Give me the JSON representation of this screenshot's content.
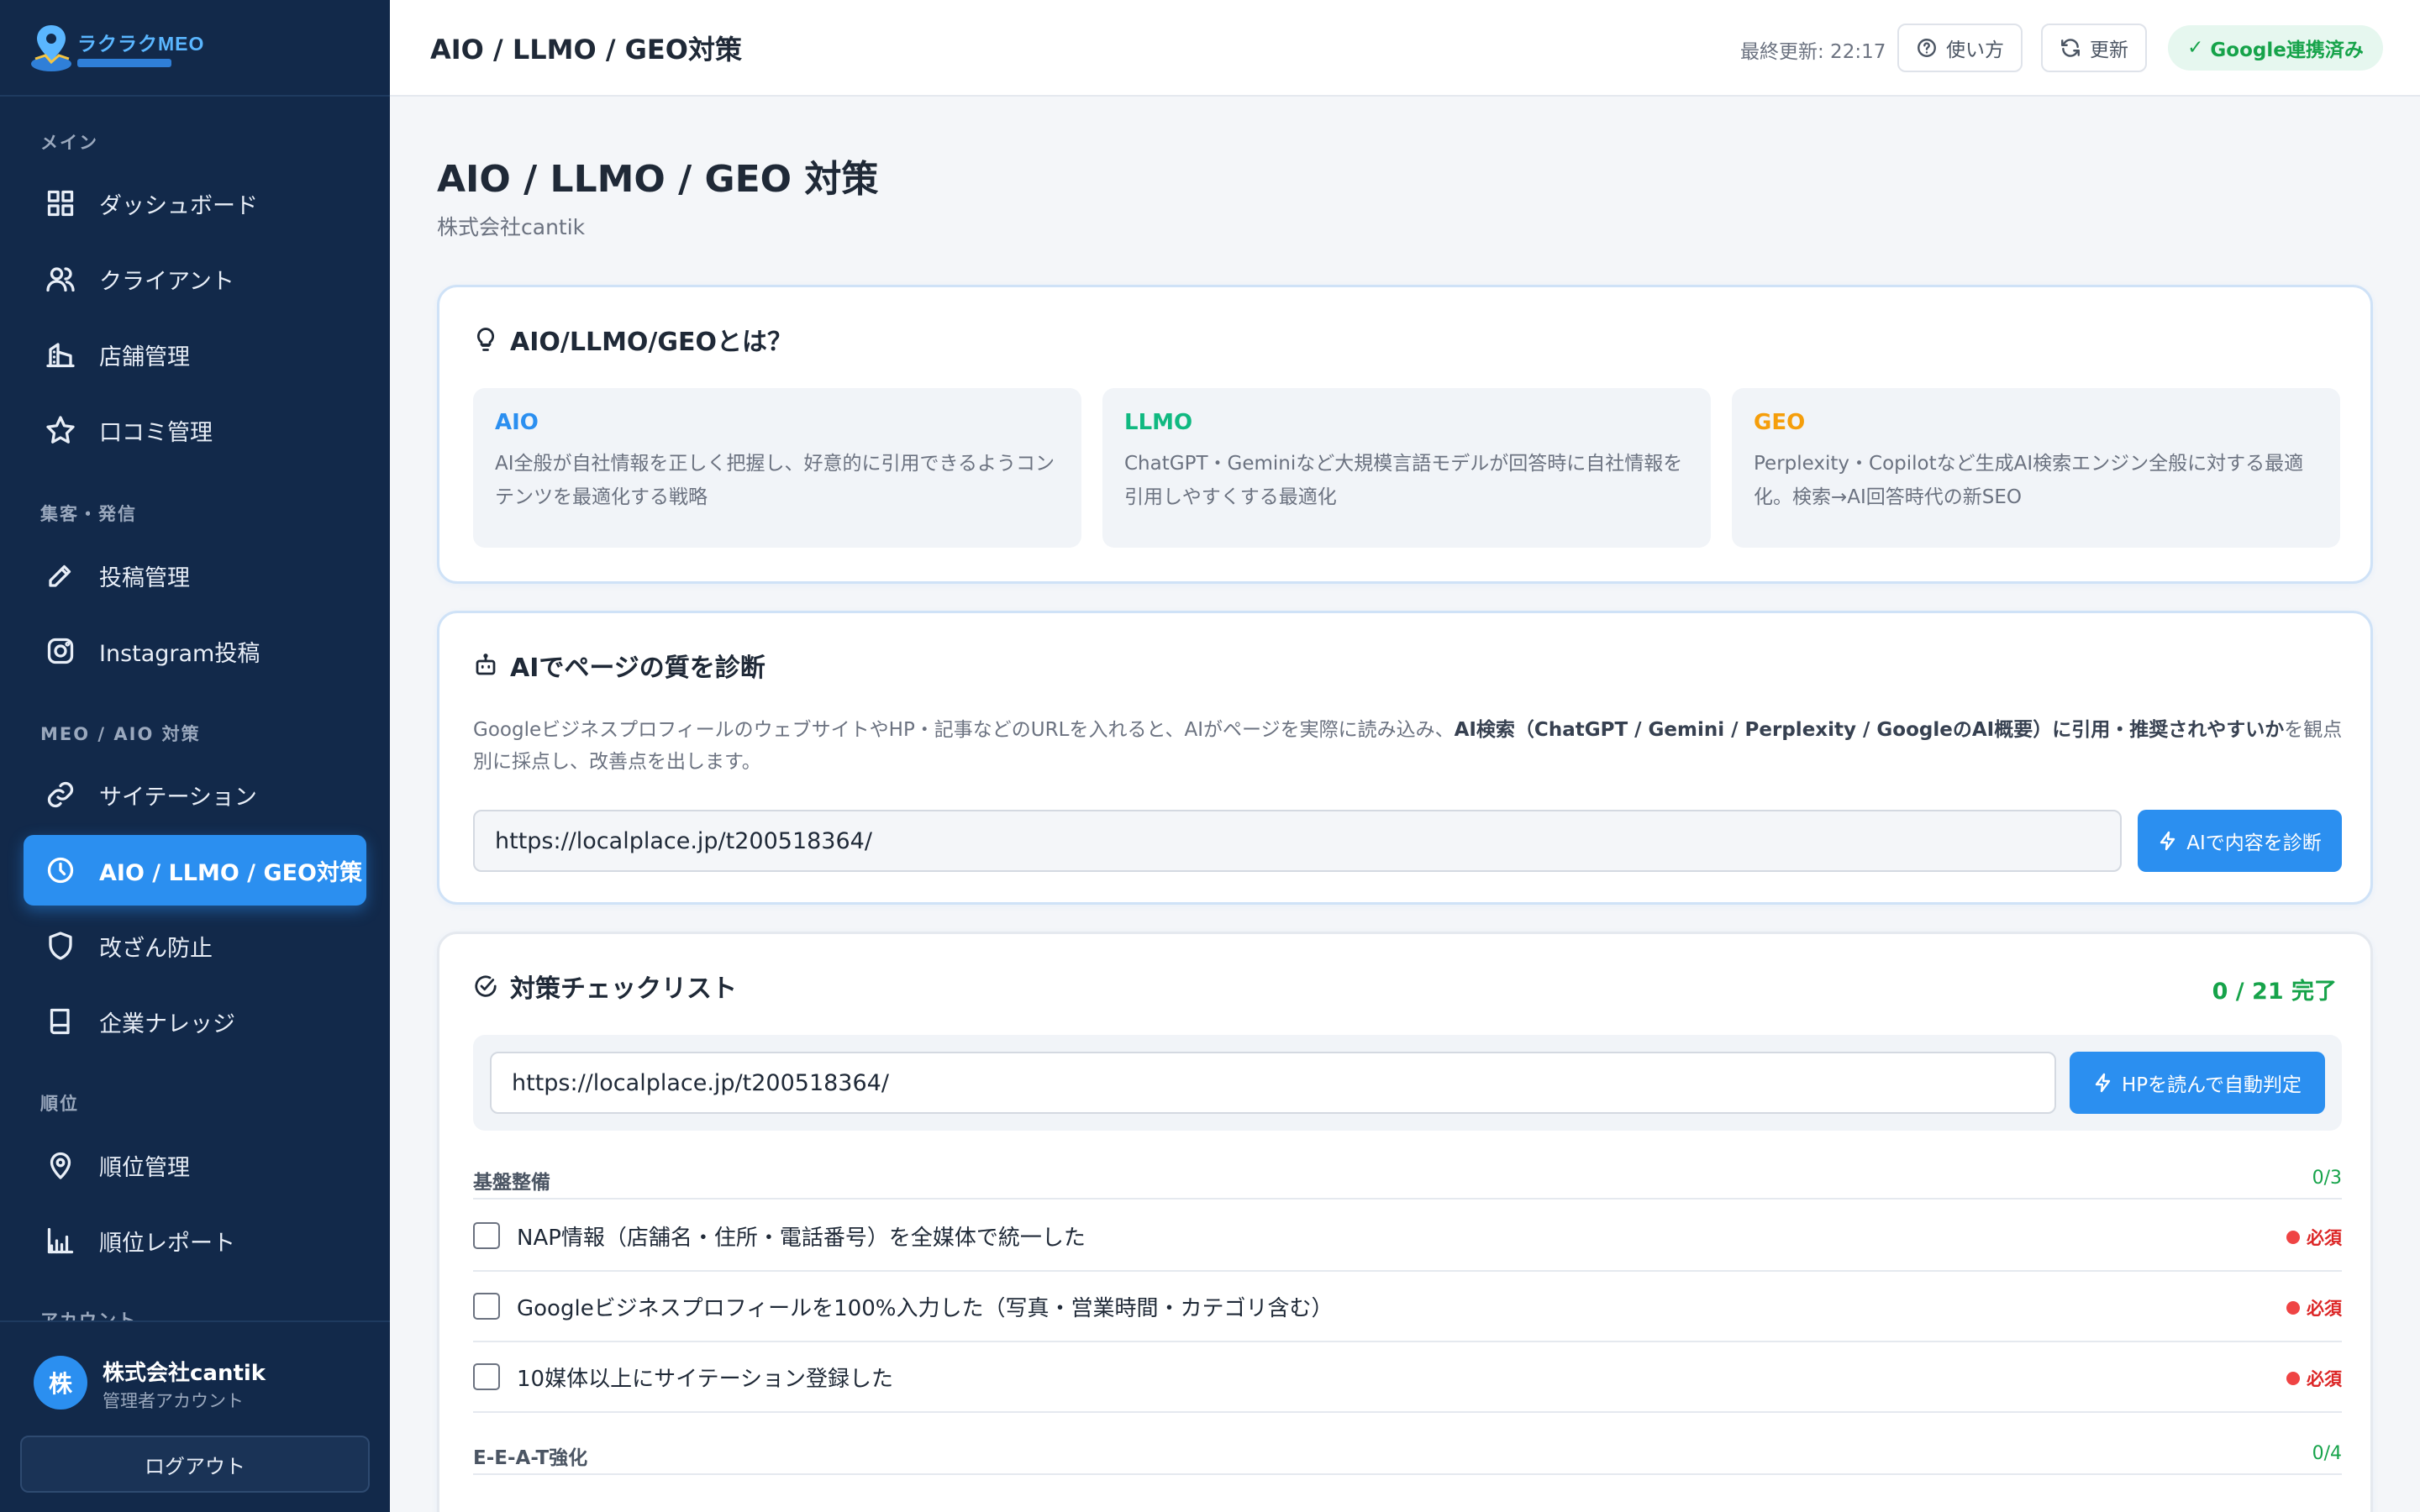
{
  "app": {
    "logo_text": "ラクラクMEO"
  },
  "sidebar": {
    "sections": [
      {
        "label": "メイン"
      },
      {
        "label": "集客・発信"
      },
      {
        "label": "MEO / AIO 対策"
      },
      {
        "label": "順位"
      },
      {
        "label": "アカウント"
      }
    ],
    "items": [
      {
        "label": "ダッシュボード",
        "icon": "grid-icon"
      },
      {
        "label": "クライアント",
        "icon": "users-icon"
      },
      {
        "label": "店舗管理",
        "icon": "building-icon"
      },
      {
        "label": "口コミ管理",
        "icon": "star-icon"
      },
      {
        "label": "投稿管理",
        "icon": "pencil-icon"
      },
      {
        "label": "Instagram投稿",
        "icon": "instagram-icon"
      },
      {
        "label": "サイテーション",
        "icon": "link-icon"
      },
      {
        "label": "AIO / LLMO / GEO対策",
        "icon": "clock-icon",
        "active": true
      },
      {
        "label": "改ざん防止",
        "icon": "shield-icon"
      },
      {
        "label": "企業ナレッジ",
        "icon": "book-icon"
      },
      {
        "label": "順位管理",
        "icon": "map-pin-icon"
      },
      {
        "label": "順位レポート",
        "icon": "bar-chart-icon"
      }
    ],
    "user": {
      "avatar": "株",
      "name": "株式会社cantik",
      "role": "管理者アカウント"
    },
    "logout_label": "ログアウト"
  },
  "header": {
    "title": "AIO / LLMO / GEO対策",
    "last_updated": "最終更新: 22:17",
    "help_label": "使い方",
    "refresh_label": "更新",
    "google_status": "Google連携済み"
  },
  "page": {
    "title": "AIO / LLMO / GEO 対策",
    "subtitle": "株式会社cantik"
  },
  "about": {
    "title": "AIO/LLMO/GEOとは？",
    "items": [
      {
        "name": "AIO",
        "color": "#2b8ff0",
        "desc": "AI全般が自社情報を正しく把握し、好意的に引用できるようコンテンツを最適化する戦略"
      },
      {
        "name": "LLMO",
        "color": "#10b981",
        "desc": "ChatGPT・Geminiなど大規模言語モデルが回答時に自社情報を引用しやすくする最適化"
      },
      {
        "name": "GEO",
        "color": "#f59e0b",
        "desc": "Perplexity・Copilotなど生成AI検索エンジン全般に対する最適化。検索→AI回答時代の新SEO"
      }
    ]
  },
  "diagnose": {
    "title": "AIでページの質を診断",
    "desc_before": "GoogleビジネスプロフィールのウェブサイトやHP・記事などのURLを入れると、AIがページを実際に読み込み、",
    "desc_bold": "AI検索（ChatGPT / Gemini / Perplexity / GoogleのAI概要）に引用・推奨されやすいか",
    "desc_after": "を観点別に採点し、改善点を出します。",
    "url_value": "https://localplace.jp/t200518364/",
    "button_label": "AIで内容を診断"
  },
  "checklist": {
    "title": "対策チェックリスト",
    "progress": "0 / 21 完了",
    "url_value": "https://localplace.jp/t200518364/",
    "auto_button_label": "HPを読んで自動判定",
    "groups": [
      {
        "name": "基盤整備",
        "count": "0/3",
        "items": [
          {
            "label": "NAP情報（店舗名・住所・電話番号）を全媒体で統一した",
            "badge": "必須"
          },
          {
            "label": "Googleビジネスプロフィールを100%入力した（写真・営業時間・カテゴリ含む）",
            "badge": "必須"
          },
          {
            "label": "10媒体以上にサイテーション登録した",
            "badge": "必須"
          }
        ]
      },
      {
        "name": "E-E-A-T強化",
        "count": "0/4",
        "items": []
      }
    ]
  },
  "colors": {
    "sidebar_bg": "#12294a",
    "accent": "#2b8ff0",
    "success": "#16a34a",
    "danger": "#dc2626"
  }
}
